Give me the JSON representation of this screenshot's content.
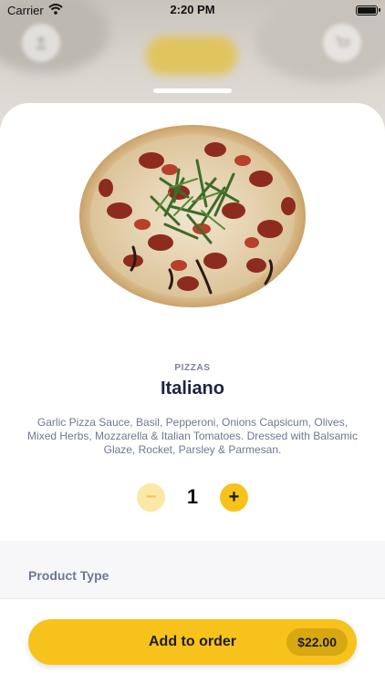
{
  "status_bar": {
    "carrier": "Carrier",
    "time": "2:20 PM"
  },
  "background": {
    "left_icon": "user-icon",
    "right_icon": "cart-icon"
  },
  "product": {
    "category": "PIZZAS",
    "name": "Italiano",
    "description": "Garlic Pizza Sauce, Basil, Pepperoni, Onions Capsicum, Olives, Mixed Herbs, Mozzarella & Italian Tomatoes. Dressed with Balsamic Glaze, Rocket, Parsley & Parmesan.",
    "image_icon": "pizza-image"
  },
  "stepper": {
    "minus_label": "−",
    "quantity": "1",
    "plus_label": "+"
  },
  "options": {
    "section_title": "Product Type"
  },
  "footer": {
    "add_label": "Add to order",
    "price": "$22.00"
  },
  "colors": {
    "accent": "#f7c21b",
    "accent_light": "#fbe7a6",
    "title": "#1d2545",
    "muted": "#6d7891"
  }
}
